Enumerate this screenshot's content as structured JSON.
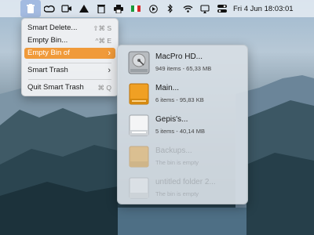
{
  "colors": {
    "accent": "#f09a3a",
    "menu_bg": "#f0f1f3",
    "menubar_bg": "#e8eef4"
  },
  "menubar": {
    "icons": [
      "trash-icon",
      "creative-cloud-icon",
      "video-icon",
      "drive-icon",
      "bin-icon",
      "printer-icon",
      "flag-icon",
      "play-icon",
      "bluetooth-icon",
      "wifi-icon",
      "airplay-icon",
      "control-center-icon"
    ],
    "clock": "Fri 4 Jun  18:03:01"
  },
  "menu": {
    "items": [
      {
        "label": "Smart Delete...",
        "shortcut": "⇧⌘ S"
      },
      {
        "label": "Empty Bin...",
        "shortcut": "^⌘ E"
      },
      {
        "label": "Empty Bin of",
        "shortcut": ""
      },
      {
        "label": "Smart Trash",
        "shortcut": ""
      },
      {
        "label": "Quit Smart Trash",
        "shortcut": "⌘ Q"
      }
    ]
  },
  "submenu": {
    "items": [
      {
        "name": "MacPro HD...",
        "info": "949 items - 65,33 MB",
        "icon": "internal-disk-icon",
        "enabled": true
      },
      {
        "name": "Main...",
        "info": "6 items - 95,83 KB",
        "icon": "orange-disk-icon",
        "enabled": true
      },
      {
        "name": "Gepis's...",
        "info": "5 items - 40,14 MB",
        "icon": "white-disk-icon",
        "enabled": true
      },
      {
        "name": "Backups...",
        "info": "The bin is empty",
        "icon": "orange-disk-icon",
        "enabled": false
      },
      {
        "name": "untitled folder 2...",
        "info": "The bin is empty",
        "icon": "white-disk-icon",
        "enabled": false
      }
    ]
  }
}
